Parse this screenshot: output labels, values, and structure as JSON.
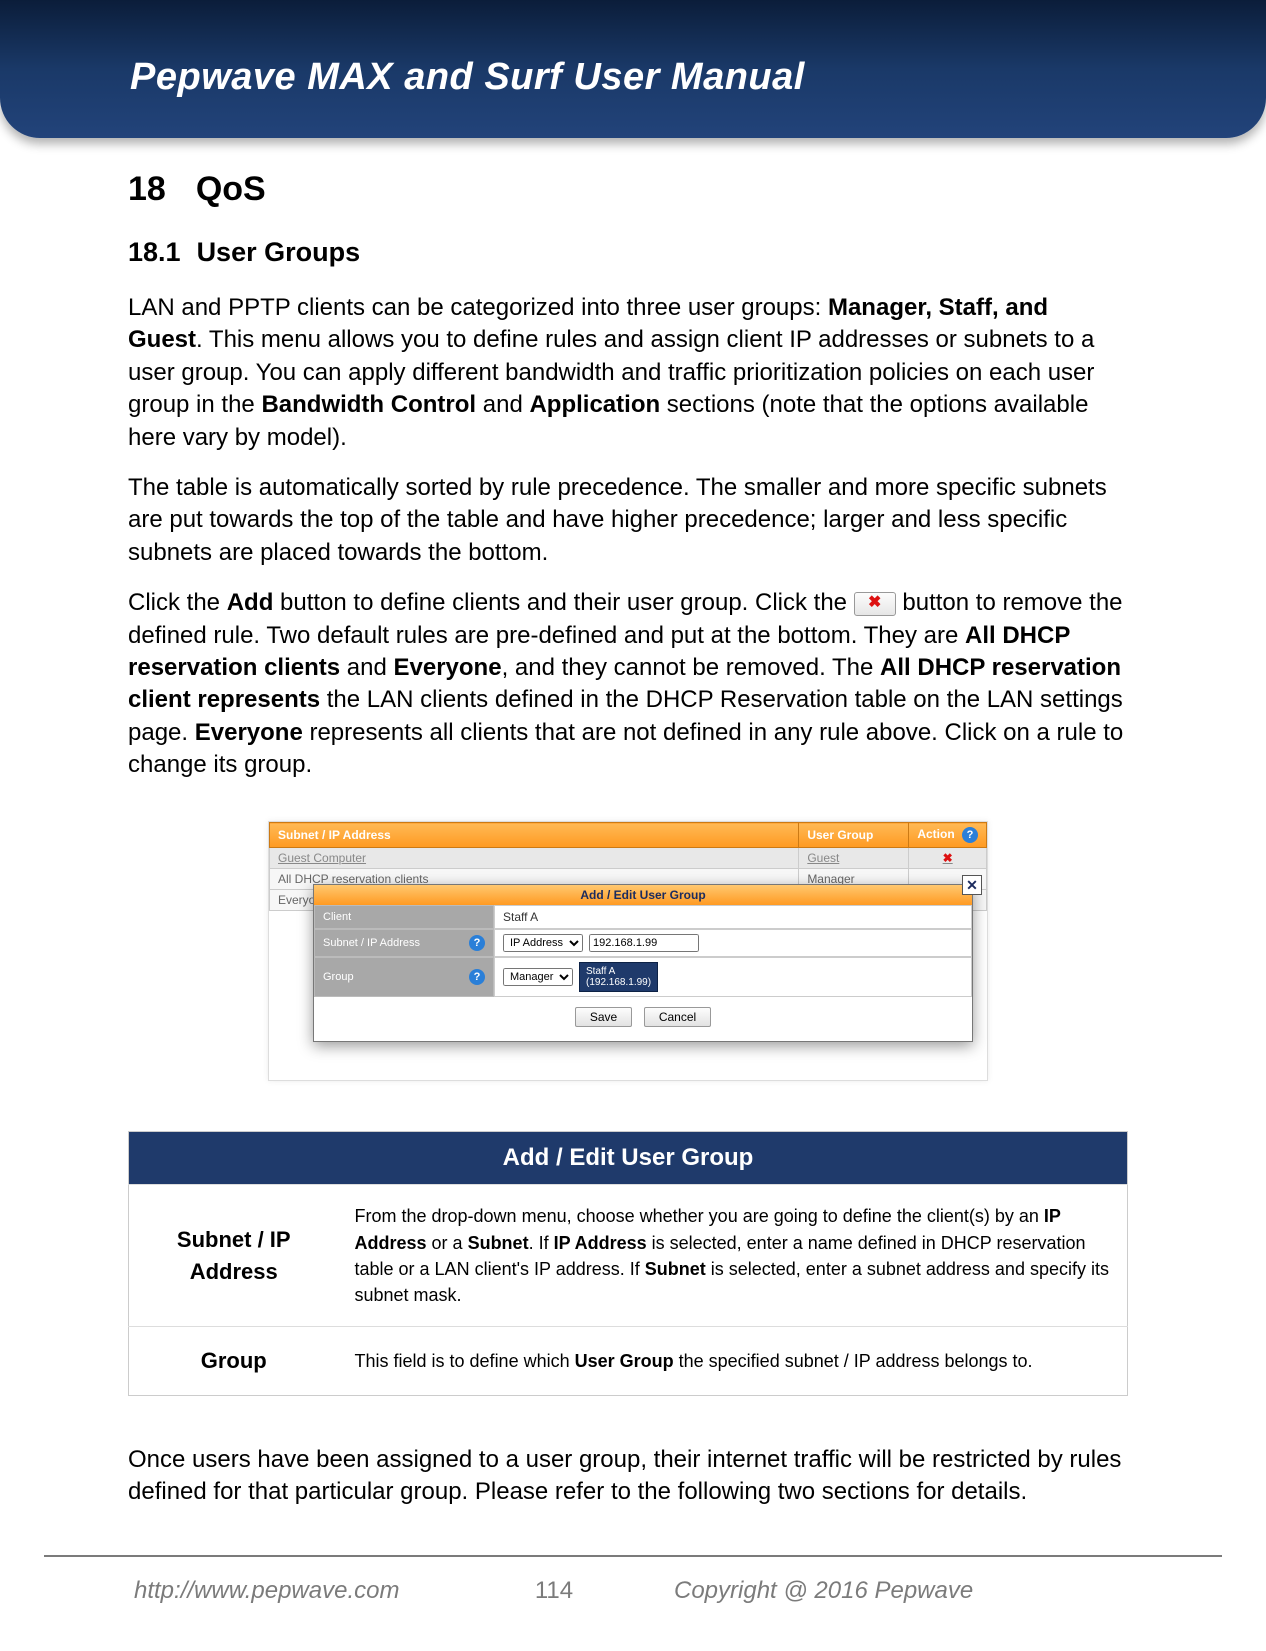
{
  "header": {
    "title": "Pepwave MAX and Surf User Manual"
  },
  "section": {
    "num": "18",
    "title": "QoS"
  },
  "subsection": {
    "num": "18.1",
    "title": "User Groups"
  },
  "para1": {
    "t1": "LAN and PPTP clients can be categorized into three user groups: ",
    "b1": "Manager, Staff, and Guest",
    "t2": ". This menu allows you to define rules and assign client IP addresses or subnets to a user group. You can apply different bandwidth and traffic prioritization policies on each user group in the ",
    "b2": "Bandwidth Control",
    "t3": " and ",
    "b3": "Application",
    "t4": " sections (note that the options available here vary by model)."
  },
  "para2": "The table is automatically sorted by rule precedence. The smaller and more specific subnets are put towards the top of the table and have higher precedence; larger and less specific subnets are placed towards the bottom.",
  "para3": {
    "t1": "Click the ",
    "b1": "Add",
    "t2": " button to define clients and their user group. Click the ",
    "t3": " button to remove the defined rule. Two default rules are pre-defined and put at the bottom. They are ",
    "b2": "All DHCP reservation clients",
    "t4": " and ",
    "b3": "Everyone",
    "t5": ", and they cannot be removed. The ",
    "b4": "All DHCP reservation client represents",
    "t6": " the LAN clients defined in the DHCP Reservation table on the LAN settings page. ",
    "b5": "Everyone",
    "t7": " represents all clients that are not defined in any rule above. Click on a rule to change its group."
  },
  "ug_table": {
    "headers": {
      "subnet": "Subnet / IP Address",
      "group": "User Group",
      "action": "Action"
    },
    "rows": [
      {
        "subnet": "Guest Computer",
        "group": "Guest",
        "removable": true
      },
      {
        "subnet": "All DHCP reservation clients",
        "group": "Manager",
        "removable": false
      },
      {
        "subnet": "Everyone",
        "group": "",
        "removable": false
      }
    ]
  },
  "modal": {
    "title": "Add / Edit User Group",
    "labels": {
      "client": "Client",
      "subnet": "Subnet / IP Address",
      "group": "Group"
    },
    "values": {
      "client": "Staff A",
      "subnet_type": "IP Address",
      "subnet_ip": "192.168.1.99",
      "group": "Manager"
    },
    "tooltip": {
      "line1": "Staff A",
      "line2": "(192.168.1.99)"
    },
    "buttons": {
      "save": "Save",
      "cancel": "Cancel"
    }
  },
  "desc": {
    "heading": "Add / Edit User Group",
    "rows": [
      {
        "label": "Subnet / IP Address",
        "t1": "From the drop-down menu, choose whether you are going to define the client(s) by an ",
        "b1": "IP Address",
        "t2": " or a ",
        "b2": "Subnet",
        "t3": ". If ",
        "b3": "IP Address",
        "t4": " is selected, enter a name defined in DHCP reservation table or a LAN client's IP address. If ",
        "b4": "Subnet",
        "t5": " is selected, enter a subnet address and specify its subnet mask."
      },
      {
        "label": "Group",
        "t1": "This field is to define which ",
        "b1": "User Group",
        "t2": " the specified subnet / IP address belongs to."
      }
    ]
  },
  "para4": "Once users have been assigned to a user group, their internet traffic will be restricted by rules defined for that particular group. Please refer to the following two sections for details.",
  "footer": {
    "url": "http://www.pepwave.com",
    "page": "114",
    "copyright": "Copyright @ 2016 Pepwave"
  },
  "glyphs": {
    "x": "✖",
    "help": "?",
    "close": "✕",
    "dropdown": "▾"
  }
}
